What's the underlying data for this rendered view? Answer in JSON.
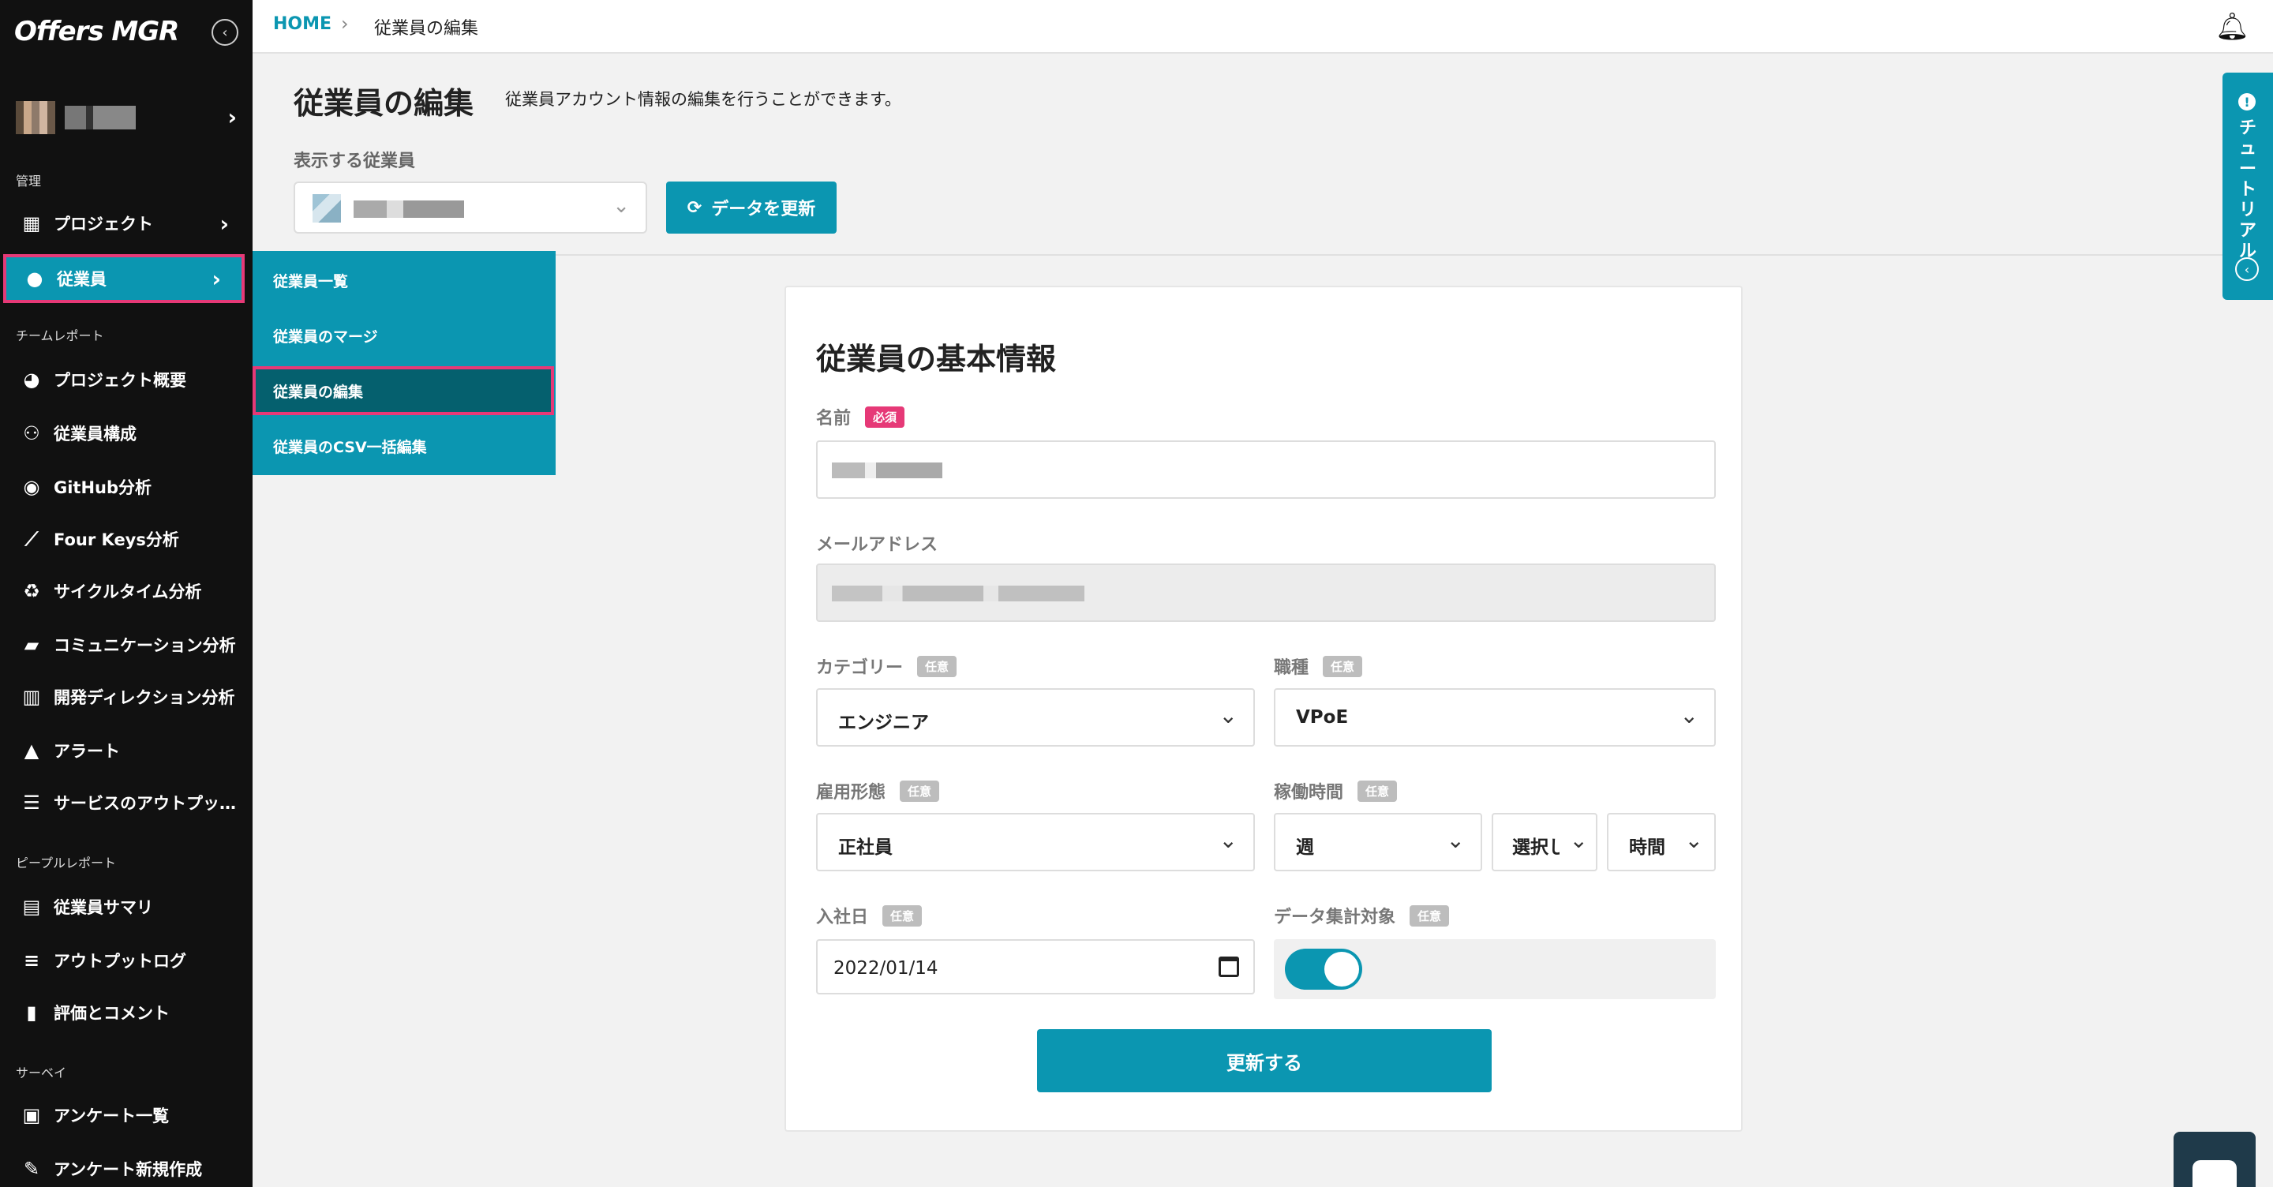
{
  "app": {
    "logo": "Offers MGR"
  },
  "sidebar": {
    "sections": {
      "manage": "管理",
      "team_report": "チームレポート",
      "people_report": "ピープルレポート",
      "survey": "サーベイ"
    },
    "items": [
      {
        "label": "プロジェクト",
        "icon": "building-icon"
      },
      {
        "label": "従業員",
        "icon": "user-icon"
      },
      {
        "label": "プロジェクト概要",
        "icon": "pie-chart-icon"
      },
      {
        "label": "従業員構成",
        "icon": "users-icon"
      },
      {
        "label": "GitHub分析",
        "icon": "github-icon"
      },
      {
        "label": "Four Keys分析",
        "icon": "line-chart-icon"
      },
      {
        "label": "サイクルタイム分析",
        "icon": "recycle-icon"
      },
      {
        "label": "コミュニケーション分析",
        "icon": "chat-icon"
      },
      {
        "label": "開発ディレクション分析",
        "icon": "bar-chart-icon"
      },
      {
        "label": "アラート",
        "icon": "bell-icon"
      },
      {
        "label": "サービスのアウトプット…",
        "icon": "server-icon"
      },
      {
        "label": "従業員サマリ",
        "icon": "id-card-icon"
      },
      {
        "label": "アウトプットログ",
        "icon": "list-icon"
      },
      {
        "label": "評価とコメント",
        "icon": "file-icon"
      },
      {
        "label": "アンケート一覧",
        "icon": "survey-icon"
      },
      {
        "label": "アンケート新規作成",
        "icon": "edit-icon"
      }
    ]
  },
  "submenu": {
    "items": [
      "従業員一覧",
      "従業員のマージ",
      "従業員の編集",
      "従業員のCSV一括編集"
    ]
  },
  "breadcrumb": {
    "home": "HOME",
    "current": "従業員の編集"
  },
  "header": {
    "title": "従業員の編集",
    "description": "従業員アカウント情報の編集を行うことができます。",
    "employee_label": "表示する従業員",
    "refresh_label": "データを更新"
  },
  "form": {
    "title": "従業員の基本情報",
    "required_badge": "必須",
    "optional_badge": "任意",
    "name_label": "名前",
    "email_label": "メールアドレス",
    "category_label": "カテゴリー",
    "category_value": "エンジニア",
    "job_label": "職種",
    "job_value": "VPoE",
    "employment_label": "雇用形態",
    "employment_value": "正社員",
    "hours_label": "稼働時間",
    "hours_period": "週",
    "hours_select": "選択し",
    "hours_unit": "時間",
    "join_label": "入社日",
    "join_value": "2022/01/14",
    "aggregate_label": "データ集計対象",
    "aggregate_on": true,
    "submit_label": "更新する"
  },
  "tutorial": {
    "label": "チュートリアル"
  }
}
